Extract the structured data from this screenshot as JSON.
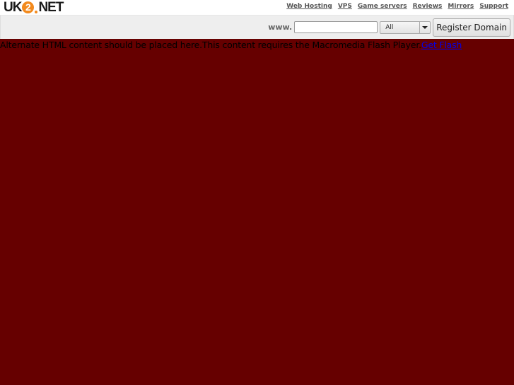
{
  "brand": {
    "logo_prefix": "UK",
    "logo_digit": "2",
    "logo_suffix": "NET",
    "accent_color": "#f28a1e"
  },
  "nav": {
    "items": [
      {
        "label": "Web Hosting"
      },
      {
        "label": "VPS"
      },
      {
        "label": "Game servers"
      },
      {
        "label": "Reviews"
      },
      {
        "label": "Mirrors"
      },
      {
        "label": "Support"
      }
    ]
  },
  "domain_search": {
    "prefix_label": "www.",
    "input_value": "",
    "input_placeholder": "",
    "tld_selected": "All",
    "register_label": "Register Domain"
  },
  "flash": {
    "background_color": "#660000",
    "alt_text": "Alternate HTML content should be placed here.This content requires the Macromedia Flash Player.",
    "link_label": "Get Flash"
  }
}
